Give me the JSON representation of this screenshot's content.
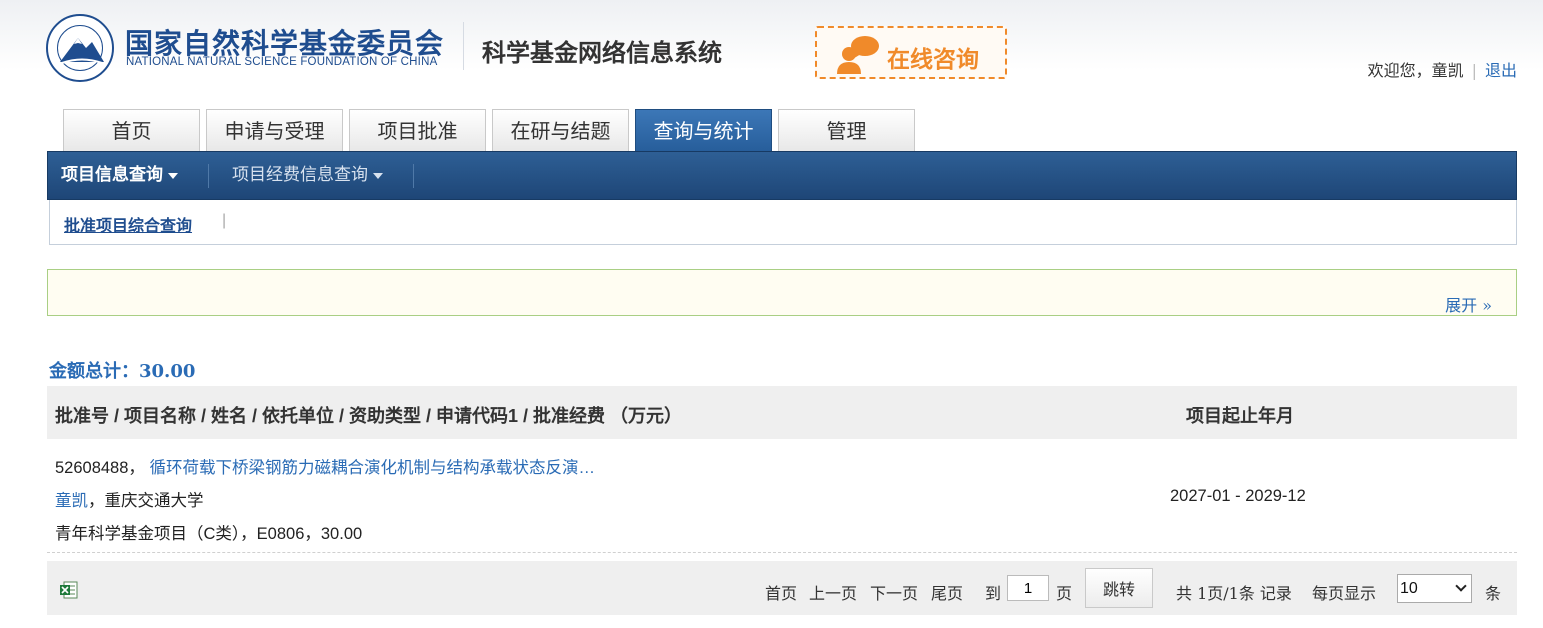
{
  "header": {
    "org_cn": "国家自然科学基金委员会",
    "org_en": "NATIONAL NATURAL SCIENCE FOUNDATION OF CHINA",
    "system_title": "科学基金网络信息系统",
    "consult_label": "在线咨询",
    "welcome": "欢迎您，童凯",
    "logout": "退出"
  },
  "tabs": [
    {
      "label": "首页"
    },
    {
      "label": "申请与受理"
    },
    {
      "label": "项目批准"
    },
    {
      "label": "在研与结题"
    },
    {
      "label": "查询与统计",
      "active": true
    },
    {
      "label": "管理"
    }
  ],
  "subnav": {
    "items": [
      {
        "label": "项目信息查询",
        "active": true
      },
      {
        "label": "项目经费信息查询"
      }
    ],
    "sub_link": "批准项目综合查询"
  },
  "filter": {
    "expand_label": "展开 »"
  },
  "summary": {
    "total": "金额总计：30.00"
  },
  "table": {
    "headers": [
      "批准号 / 项目名称 / 姓名 / 依托单位 / 资助类型 / 申请代码1 / 批准经费 （万元）",
      "项目起止年月"
    ],
    "rows": [
      {
        "approval_no": "52608488，",
        "project_name": "循环荷载下桥梁钢筋力磁耦合演化机制与结构承载状态反演…",
        "person": "童凯",
        "institution": "，重庆交通大学",
        "funding_line": "青年科学基金项目（C类），E0806，30.00",
        "period": "2027-01 - 2029-12"
      }
    ]
  },
  "pager": {
    "first": "首页",
    "prev": "上一页",
    "next": "下一页",
    "last": "尾页",
    "to_label": "到",
    "page_value": "1",
    "page_unit": "页",
    "jump_label": "跳转",
    "summary": "共 1页/1条 记录",
    "per_page_label": "每页显示",
    "per_page_value": "10",
    "per_page_unit": "条"
  },
  "colors": {
    "brand_blue": "#1f4d8f",
    "link_blue": "#2a6bb5",
    "consult_orange": "#f08a2a"
  }
}
